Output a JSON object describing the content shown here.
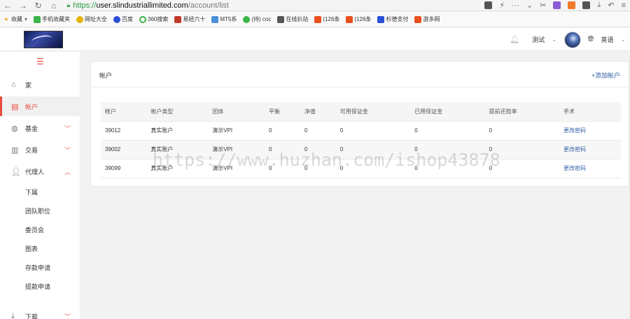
{
  "browser": {
    "url_scheme": "https://",
    "url_host": "user.slindustriallimited.com",
    "url_path": "/account/list",
    "bookmarks": [
      {
        "label": "收藏",
        "icon": "star-icon",
        "color": "#f5a623"
      },
      {
        "label": "手机收藏夹",
        "icon": "phone-icon",
        "color": "#3bb54a"
      },
      {
        "label": "网址大全",
        "icon": "smile-icon",
        "color": "#e3b400"
      },
      {
        "label": "百度",
        "icon": "baidu-paw-icon",
        "color": "#2a4fd6"
      },
      {
        "label": "360搜索",
        "icon": "circle-icon",
        "color": "#3bb54a"
      },
      {
        "label": "易经六十",
        "icon": "site-icon",
        "color": "#c0392b"
      },
      {
        "label": "MT5系",
        "icon": "mt5-icon",
        "color": "#4a90d9"
      },
      {
        "label": "(待) coc",
        "icon": "c-icon",
        "color": "#3bb54a"
      },
      {
        "label": "在线扒站",
        "icon": "site-icon",
        "color": "#555555"
      },
      {
        "label": "(126条",
        "icon": "c-icon",
        "color": "#e8501e"
      },
      {
        "label": "(126条",
        "icon": "c-icon",
        "color": "#e8501e"
      },
      {
        "label": "杉德支付",
        "icon": "site-icon",
        "color": "#2a4fd6"
      },
      {
        "label": "游多网",
        "icon": "site-icon",
        "color": "#e8501e"
      }
    ]
  },
  "header": {
    "user_name": "测试",
    "language": "英语"
  },
  "sidebar": {
    "items": [
      {
        "label": "家",
        "icon": "home-icon",
        "top": 0
      },
      {
        "label": "帐户",
        "icon": "account-icon",
        "active": true
      },
      {
        "label": "基金",
        "icon": "globe-icon"
      },
      {
        "label": "交易",
        "icon": "chart-bars-icon"
      },
      {
        "label": "代理人",
        "icon": "user-icon"
      }
    ],
    "sub_items": [
      "下属",
      "团队职位",
      "委员会",
      "图表",
      "存款申请",
      "提款申请"
    ],
    "download": "下载"
  },
  "main": {
    "title": "帐户",
    "add_label": "+添加帐户",
    "columns": [
      "帐户",
      "帐户类型",
      "团体",
      "平衡",
      "净值",
      "可用保证金",
      "已用保证金",
      "提前还款率",
      "手术"
    ],
    "rows": [
      [
        "39012",
        "真实账户",
        "演示VPI",
        "0",
        "0",
        "0",
        "0",
        "0",
        "更改密码"
      ],
      [
        "39002",
        "真实账户",
        "演示VPI",
        "0",
        "0",
        "0",
        "0",
        "0",
        "更改密码"
      ],
      [
        "39099",
        "真实账户",
        "演示VPI",
        "0",
        "0",
        "0",
        "0",
        "0",
        "更改密码"
      ]
    ]
  },
  "watermark": "https://www.huzhan.com/ishop43878"
}
